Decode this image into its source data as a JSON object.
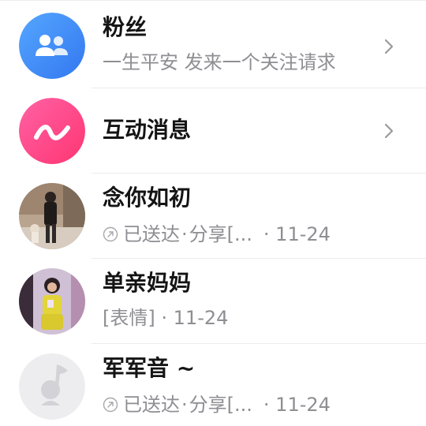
{
  "rows": [
    {
      "title": "粉丝",
      "subtitle": "一生平安 发来一个关注请求"
    },
    {
      "title": "互动消息"
    },
    {
      "title": "念你如初",
      "status": "已送达",
      "separator": "·",
      "preview": "分享[...",
      "time_prefix": "·",
      "time": "11-24"
    },
    {
      "title": "单亲妈妈",
      "preview": "[表情]",
      "time_prefix": "·",
      "time": "11-24"
    },
    {
      "title": "军军音 ~",
      "status": "已送达",
      "separator": "·",
      "preview": "分享[...",
      "time_prefix": "·",
      "time": "11-24"
    }
  ],
  "icons": {
    "fans": "fans-icon",
    "interaction": "interaction-icon",
    "chevron": "chevron-right-icon",
    "sent_status": "sent-status-icon"
  },
  "colors": {
    "fans_gradient": [
      "#4f9dfb",
      "#3a7ff5"
    ],
    "interaction_gradient": [
      "#ff5a9e",
      "#ff3a78"
    ],
    "title_text": "#141414",
    "subtitle_text": "#8e8e93",
    "divider": "#ececec"
  }
}
